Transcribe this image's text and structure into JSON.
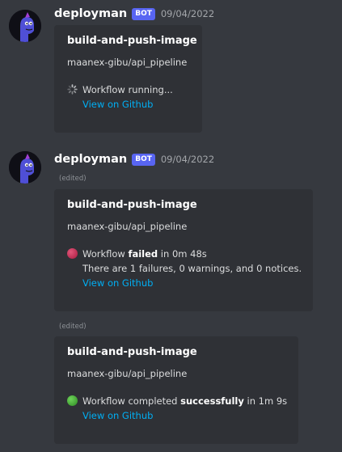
{
  "messages": [
    {
      "username": "deployman",
      "badge": "BOT",
      "timestamp": "09/04/2022",
      "embed": {
        "title": "build-and-push-image",
        "repo": "maanex-gibu/api_pipeline",
        "status_text": "Workflow running...",
        "link": "View on Github"
      }
    },
    {
      "username": "deployman",
      "badge": "BOT",
      "timestamp": "09/04/2022",
      "edited": "(edited)",
      "embed": {
        "title": "build-and-push-image",
        "repo": "maanex-gibu/api_pipeline",
        "status_prefix": "Workflow ",
        "status_bold": "failed",
        "status_suffix": " in 0m 48s",
        "detail": "There are 1 failures, 0 warnings, and 0 notices.",
        "link": "View on Github"
      }
    },
    {
      "edited": "(edited)",
      "embed": {
        "title": "build-and-push-image",
        "repo": "maanex-gibu/api_pipeline",
        "status_prefix": "Workflow completed ",
        "status_bold": "successfully",
        "status_suffix": " in 1m 9s",
        "link": "View on Github"
      }
    }
  ],
  "colors": {
    "background": "#36393f",
    "embed_background": "#2f3136",
    "link": "#00aff4",
    "bot_badge": "#5865f2",
    "failed_dot": "#c4294f",
    "success_dot": "#43b02a"
  },
  "icons": {
    "avatar": "purple-character-avatar-icon",
    "running": "spinner-icon",
    "failed": "red-circle-icon",
    "success": "green-circle-icon"
  }
}
